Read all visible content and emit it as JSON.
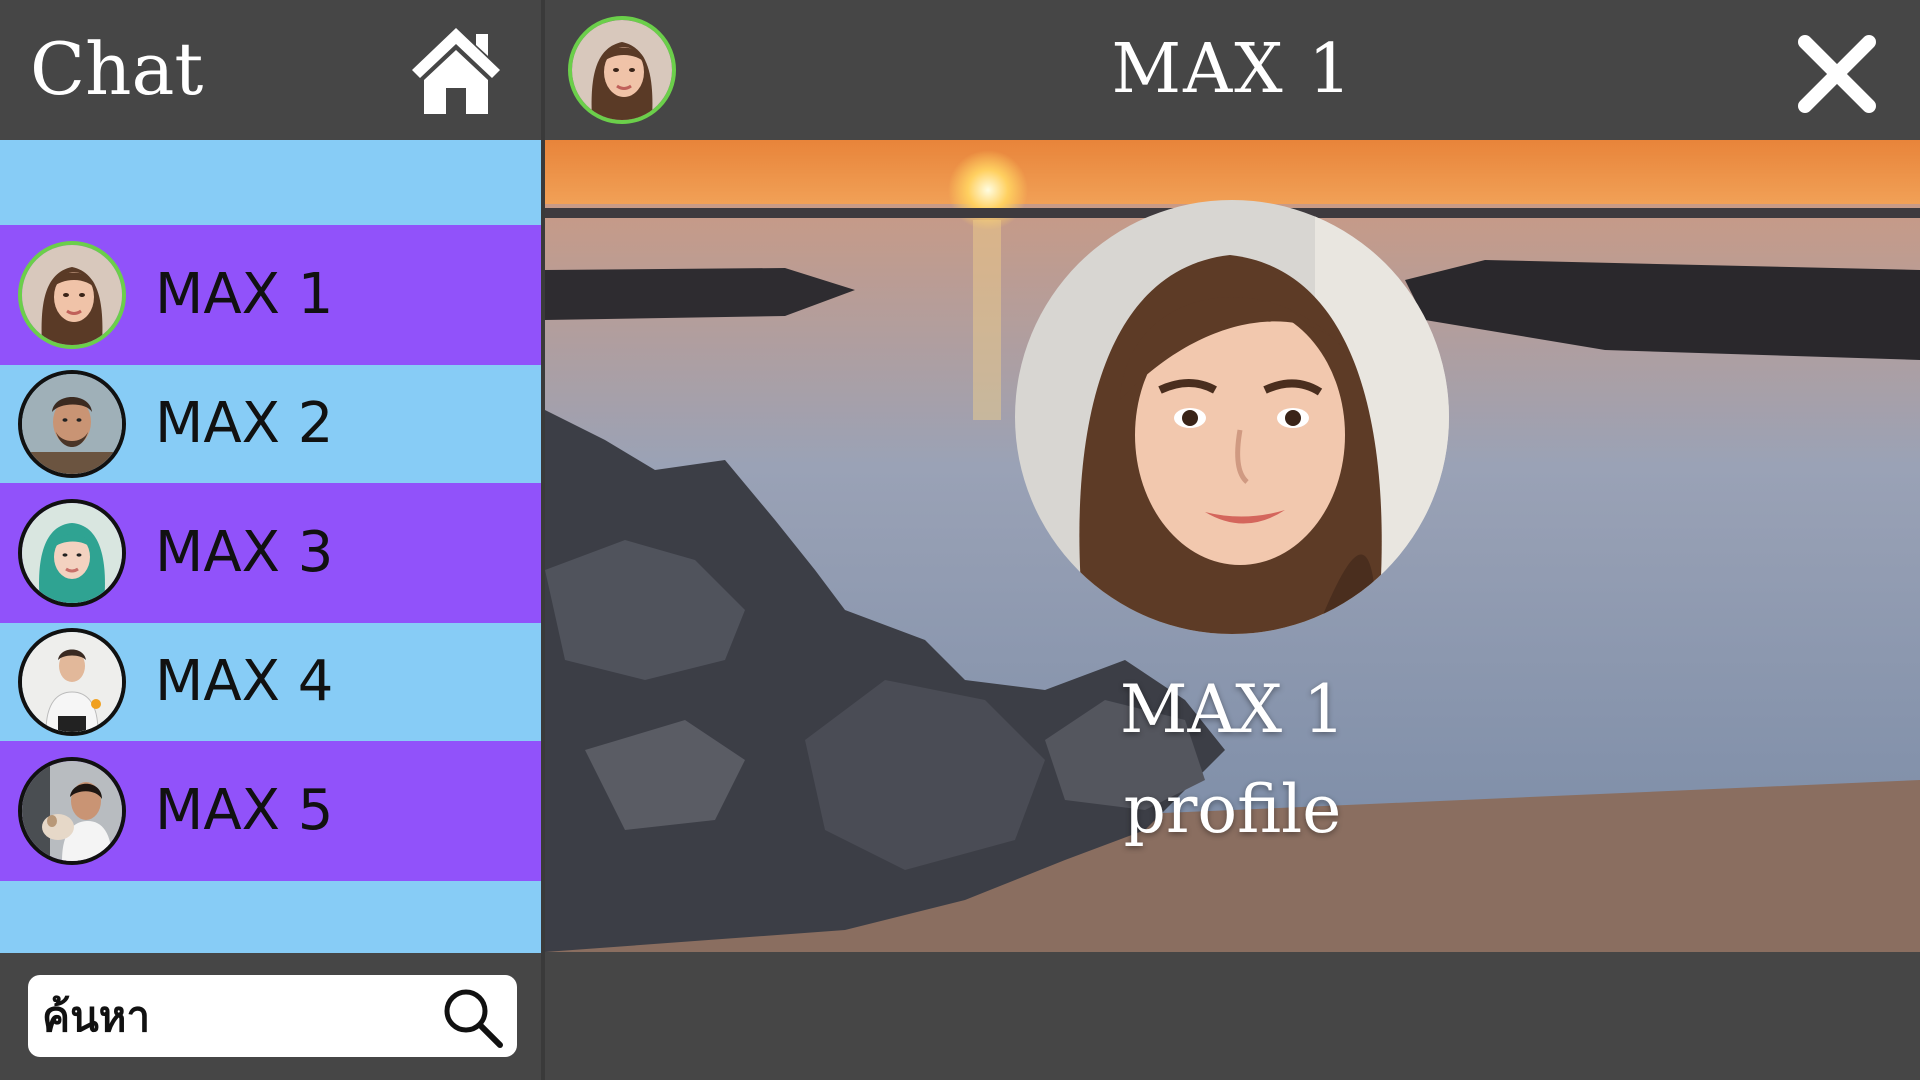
{
  "app": {
    "title": "Chat",
    "home_icon": "home-icon",
    "colors": {
      "background": "#464646",
      "list_light": "#87ccf6",
      "list_active": "#9152fa",
      "online_ring": "#6bcf4a",
      "text_light": "#ffffff"
    }
  },
  "contacts": [
    {
      "name": "MAX 1",
      "status": "online",
      "highlight": true
    },
    {
      "name": "MAX 2",
      "status": "offline",
      "highlight": false
    },
    {
      "name": "MAX 3",
      "status": "offline",
      "highlight": true
    },
    {
      "name": "MAX 4",
      "status": "offline",
      "highlight": false
    },
    {
      "name": "MAX 5",
      "status": "offline",
      "highlight": true
    }
  ],
  "search": {
    "placeholder": "ค้นหา",
    "value": "",
    "icon": "search-icon"
  },
  "chat": {
    "title": "MAX 1",
    "close_icon": "close-icon",
    "profile": {
      "name": "MAX 1",
      "subtitle": "profile"
    }
  }
}
